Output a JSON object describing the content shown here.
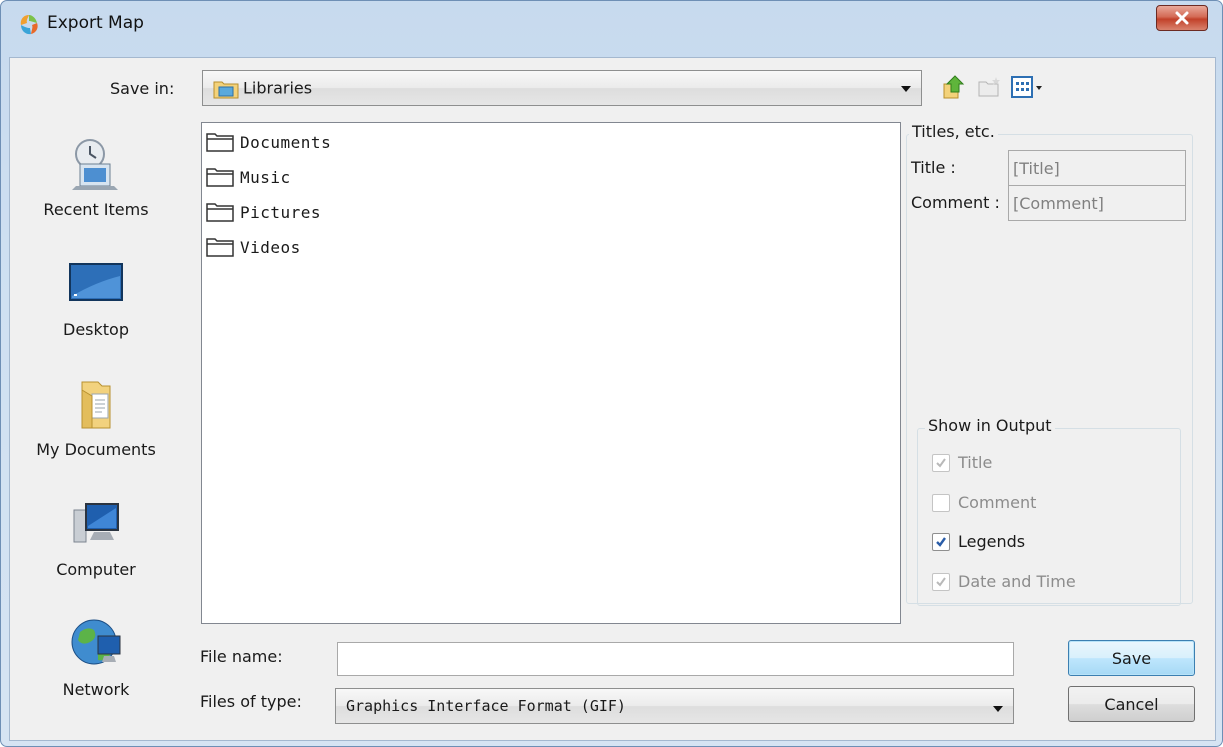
{
  "window": {
    "title": "Export Map"
  },
  "save_in": {
    "label": "Save in:",
    "value": "Libraries"
  },
  "places": [
    {
      "label": "Recent Items",
      "icon": "recent-items-icon"
    },
    {
      "label": "Desktop",
      "icon": "desktop-icon"
    },
    {
      "label": "My Documents",
      "icon": "my-documents-icon"
    },
    {
      "label": "Computer",
      "icon": "computer-icon"
    },
    {
      "label": "Network",
      "icon": "network-icon"
    }
  ],
  "files": [
    {
      "name": "Documents"
    },
    {
      "name": "Music"
    },
    {
      "name": "Pictures"
    },
    {
      "name": "Videos"
    }
  ],
  "titles_group": {
    "title": "Titles, etc.",
    "title_label": "Title :",
    "title_value": "[Title]",
    "comment_label": "Comment :",
    "comment_value": "[Comment]"
  },
  "output_group": {
    "title": "Show in Output",
    "options": [
      {
        "label": "Title",
        "checked": true,
        "enabled": false
      },
      {
        "label": "Comment",
        "checked": false,
        "enabled": false
      },
      {
        "label": "Legends",
        "checked": true,
        "enabled": true
      },
      {
        "label": "Date and Time",
        "checked": true,
        "enabled": false
      }
    ]
  },
  "file_name": {
    "label": "File name:",
    "value": ""
  },
  "file_type": {
    "label": "Files of type:",
    "value": "Graphics Interface Format (GIF)"
  },
  "buttons": {
    "save": "Save",
    "cancel": "Cancel"
  },
  "colors": {
    "accent": "#3c7fb1",
    "titlebar": "#c7daee",
    "close": "#c2412a"
  }
}
